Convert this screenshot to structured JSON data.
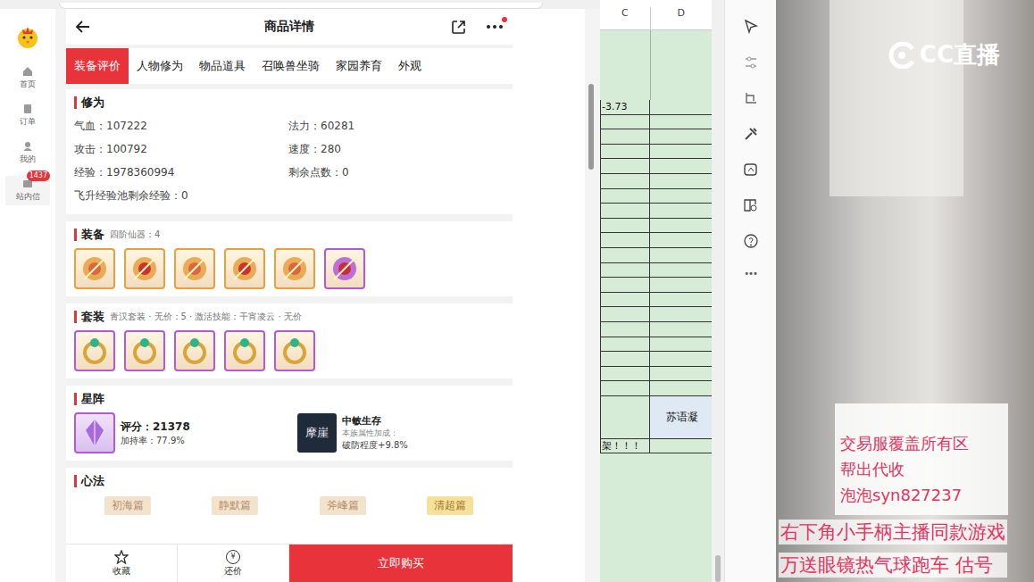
{
  "app_sidebar": {
    "items": [
      {
        "label": "首页",
        "badge": ""
      },
      {
        "label": "订单",
        "badge": ""
      },
      {
        "label": "我的",
        "badge": ""
      },
      {
        "label": "站内信",
        "badge": "1437"
      }
    ]
  },
  "header": {
    "title": "商品详情",
    "has_notification": true
  },
  "tabs": [
    {
      "label": "装备评价",
      "selected": true
    },
    {
      "label": "人物修为",
      "selected": false
    },
    {
      "label": "物品道具",
      "selected": false
    },
    {
      "label": "召唤兽坐骑",
      "selected": false
    },
    {
      "label": "家园养育",
      "selected": false
    },
    {
      "label": "外观",
      "selected": false
    }
  ],
  "cultivation": {
    "title": "修为",
    "stats": [
      "气血：107222",
      "法力：60281",
      "攻击：100792",
      "速度：280",
      "经验：1978360994",
      "剩余点数：0"
    ],
    "footer": "飞升经验池剩余经验：0"
  },
  "equipment": {
    "title": "装备",
    "subtitle": "四阶仙器：4",
    "items": [
      {
        "color": "#e8a040"
      },
      {
        "color": "#e8a040"
      },
      {
        "color": "#e8a040"
      },
      {
        "color": "#e8a040"
      },
      {
        "color": "#e8a040"
      },
      {
        "color": "#b458d8"
      }
    ]
  },
  "suit": {
    "title": "套装",
    "subtitle": "青汉套装 · 无价：5 · 激活技能：干宵凌云 · 无价",
    "items": [
      {
        "color": "#b458d8"
      },
      {
        "color": "#b458d8"
      },
      {
        "color": "#b458d8"
      },
      {
        "color": "#b458d8"
      },
      {
        "color": "#b458d8"
      }
    ]
  },
  "star": {
    "title": "星阵",
    "score": "评分：21378",
    "rate": "加持率：77.9%",
    "badge": "摩崖",
    "name": "中敏生存",
    "desc": "本族属性加成：",
    "bonus": "破防程度+9.8%"
  },
  "mind": {
    "title": "心法",
    "items": [
      "初海篇",
      "静默篇",
      "斧峰篇",
      "清超篇"
    ]
  },
  "bottom_bar": {
    "favorite": "收藏",
    "bargain_icon": "¥",
    "bargain": "还价",
    "buy": "立即购买"
  },
  "sheet": {
    "columns": [
      "C",
      "D"
    ],
    "rows": [
      {
        "c": "-3.73",
        "d": "",
        "kind": "row"
      },
      {
        "c": "",
        "d": "",
        "kind": "row"
      },
      {
        "c": "",
        "d": "",
        "kind": "row"
      },
      {
        "c": "",
        "d": "",
        "kind": "row"
      },
      {
        "c": "",
        "d": "",
        "kind": "row"
      },
      {
        "c": "",
        "d": "",
        "kind": "row"
      },
      {
        "c": "",
        "d": "",
        "kind": "row"
      },
      {
        "c": "",
        "d": "",
        "kind": "row"
      },
      {
        "c": "",
        "d": "",
        "kind": "row"
      },
      {
        "c": "",
        "d": "",
        "kind": "row"
      },
      {
        "c": "",
        "d": "",
        "kind": "row"
      },
      {
        "c": "",
        "d": "",
        "kind": "row"
      },
      {
        "c": "",
        "d": "",
        "kind": "row"
      },
      {
        "c": "",
        "d": "",
        "kind": "row"
      },
      {
        "c": "",
        "d": "",
        "kind": "row"
      },
      {
        "c": "",
        "d": "",
        "kind": "row"
      },
      {
        "c": "",
        "d": "",
        "kind": "row"
      },
      {
        "c": "",
        "d": "",
        "kind": "row"
      },
      {
        "c": "",
        "d": "",
        "kind": "row"
      },
      {
        "c": "",
        "d": "",
        "kind": "row"
      },
      {
        "c": "",
        "d": "苏语凝",
        "kind": "tall"
      },
      {
        "c": "架！！！",
        "d": "",
        "kind": "row"
      }
    ]
  },
  "toolbar": {
    "more": "•••"
  },
  "stream": {
    "logo": "CC直播",
    "overlay_box": [
      "交易服覆盖所有区",
      "帮出代收",
      "泡泡syn827237"
    ],
    "overlay_lines": [
      "右下角小手柄主播同款游戏",
      "万送眼镜热气球跑车  估号"
    ]
  }
}
